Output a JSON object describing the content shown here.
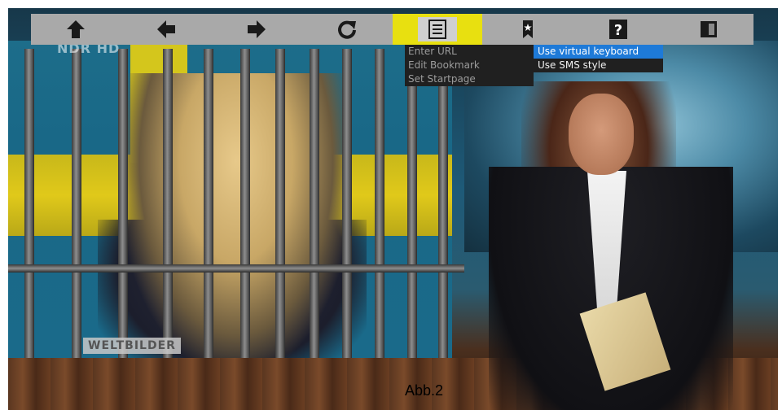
{
  "toolbar": {
    "buttons": [
      {
        "id": "home",
        "icon": "home-up-arrow-icon"
      },
      {
        "id": "back",
        "icon": "arrow-left-icon"
      },
      {
        "id": "forward",
        "icon": "arrow-right-icon"
      },
      {
        "id": "reload",
        "icon": "reload-icon"
      },
      {
        "id": "menu",
        "icon": "menu-lines-icon",
        "active": true
      },
      {
        "id": "bookmark",
        "icon": "bookmark-star-icon"
      },
      {
        "id": "help",
        "icon": "help-question-icon"
      },
      {
        "id": "exit",
        "icon": "exit-panel-icon"
      }
    ],
    "highlight_color": "#e8e010"
  },
  "menu": {
    "items": [
      {
        "label": "Enter URL"
      },
      {
        "label": "Edit Bookmark"
      },
      {
        "label": "Set Startpage"
      }
    ]
  },
  "submenu": {
    "items": [
      {
        "label": "Use virtual keyboard",
        "selected": true
      },
      {
        "label": "Use SMS style",
        "selected": false
      }
    ],
    "selected_color": "#1e7ad8"
  },
  "video": {
    "channel_logo": "NDR HD",
    "graphic_label": "WELTBILDER"
  },
  "caption": "Abb.2"
}
